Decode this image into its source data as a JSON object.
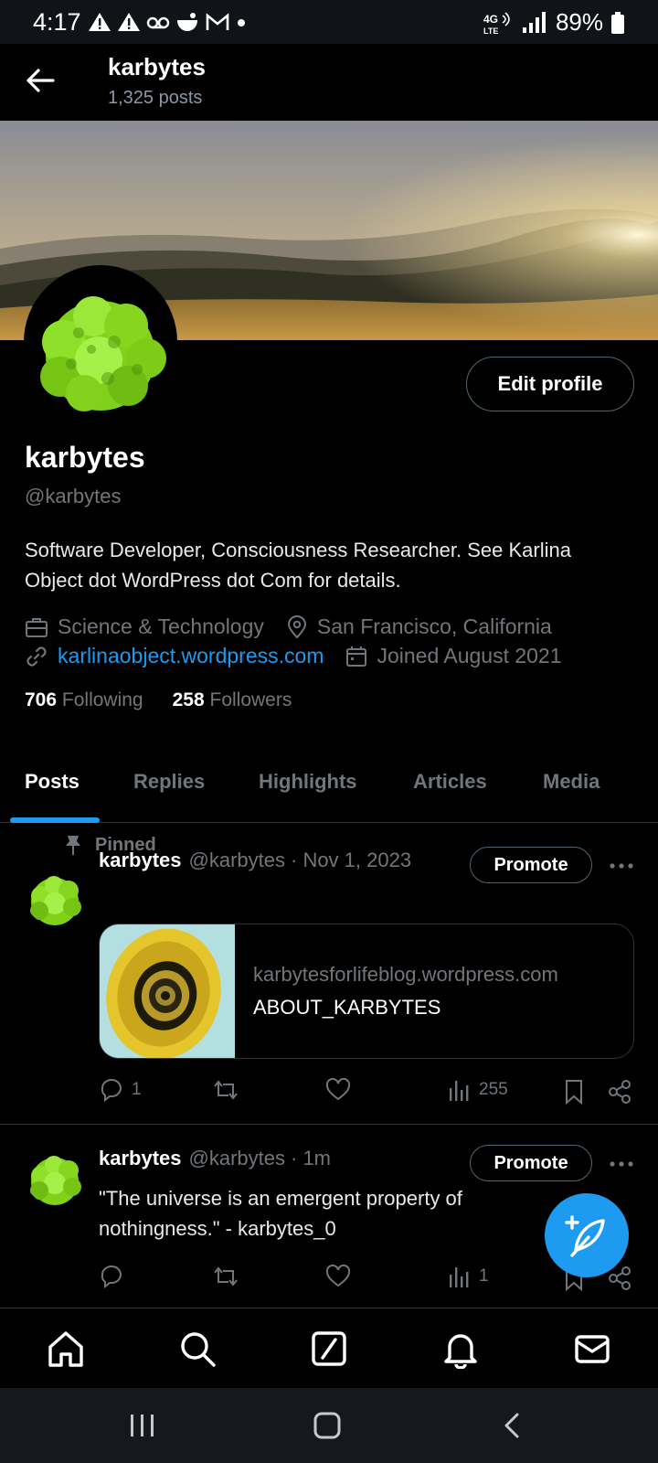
{
  "status_bar": {
    "time": "4:17",
    "network": "4G LTE",
    "battery": "89%"
  },
  "header": {
    "title": "karbytes",
    "subtitle": "1,325 posts"
  },
  "profile": {
    "name": "karbytes",
    "handle": "@karbytes",
    "edit_label": "Edit profile",
    "bio": "Software Developer, Consciousness Researcher. See Karlina Object dot WordPress dot Com for details.",
    "category": "Science & Technology",
    "location": "San Francisco, California",
    "website": "karlinaobject.wordpress.com",
    "joined": "Joined August 2021",
    "following_count": "706",
    "following_label": "Following",
    "followers_count": "258",
    "followers_label": "Followers"
  },
  "tabs": [
    {
      "label": "Posts",
      "active": true
    },
    {
      "label": "Replies",
      "active": false
    },
    {
      "label": "Highlights",
      "active": false
    },
    {
      "label": "Articles",
      "active": false
    },
    {
      "label": "Media",
      "active": false
    }
  ],
  "posts": [
    {
      "pinned_label": "Pinned",
      "author": "karbytes",
      "handle": "@karbytes",
      "time": "· Nov 1, 2023",
      "promote_label": "Promote",
      "card": {
        "domain": "karbytesforlifeblog.wordpress.com",
        "title": "ABOUT_KARBYTES"
      },
      "replies": "1",
      "views": "255"
    },
    {
      "author": "karbytes",
      "handle": "@karbytes",
      "time": "· 1m",
      "promote_label": "Promote",
      "text": "\"The universe is an emergent property of nothingness.\" - karbytes_0",
      "views": "1"
    }
  ],
  "colors": {
    "accent": "#1d9bf0",
    "background": "#000000",
    "muted_text": "#71767b",
    "border": "#2f3336"
  },
  "icons": {
    "back": "arrow-left-icon",
    "compose_fab": "feather-plus-icon",
    "nav": [
      "home-icon",
      "search-icon",
      "grok-icon",
      "bell-icon",
      "mail-icon"
    ]
  }
}
